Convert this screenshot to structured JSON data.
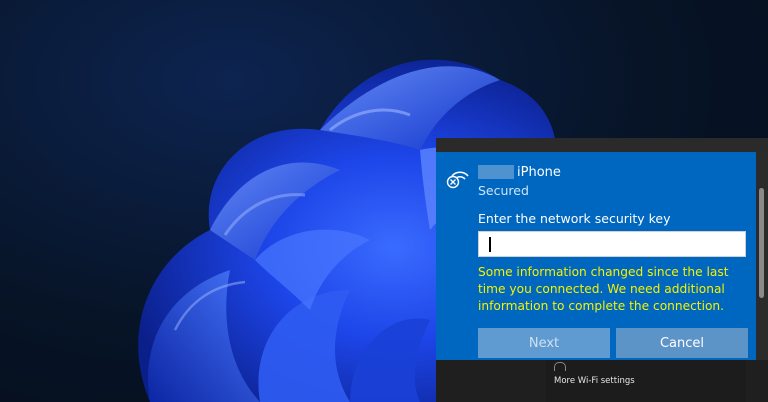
{
  "wifi_dialog": {
    "network_name": "iPhone",
    "network_status": "Secured",
    "security_key_label": "Enter the network security key",
    "security_key_value": "",
    "warning_message": "Some information changed since the last time you connected. We need additional information to complete the connection.",
    "next_button": "Next",
    "cancel_button": "Cancel",
    "icon": "wifi-secured-error-icon"
  },
  "network_list": {
    "more_settings_link": "More Wi-Fi settings"
  },
  "colors": {
    "dialog_accent": "#0067c0",
    "warning_text": "#f5f200",
    "wallpaper_bloom": "#1f4fe0"
  }
}
